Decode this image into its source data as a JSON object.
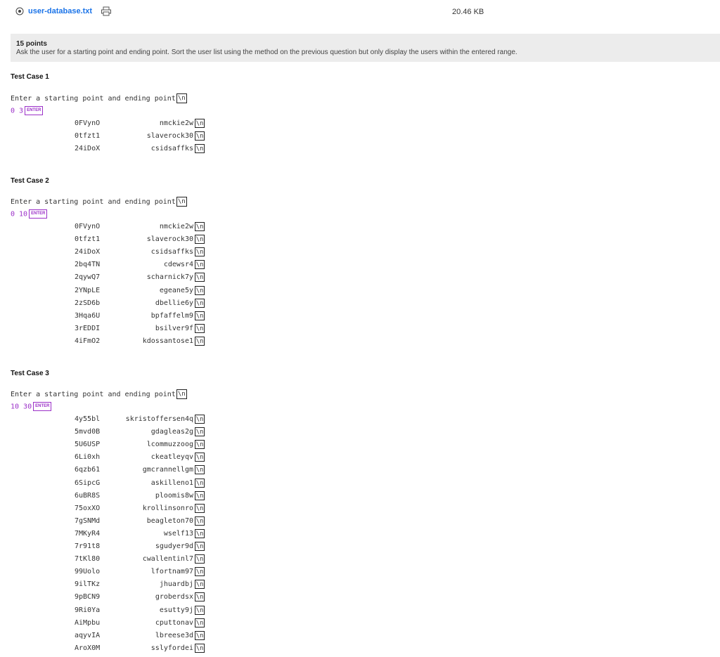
{
  "file": {
    "name": "user-database.txt",
    "size": "20.46 KB"
  },
  "question": {
    "points": "15 points",
    "prompt": "Ask the user for a starting point and ending point. Sort the user list using the method on the previous question but only display the users within the entered range."
  },
  "newline_marker": "\\n",
  "enter_label": "ENTER",
  "test_cases": [
    {
      "title": "Test Case 1",
      "prompt": "Enter a starting point and ending point",
      "input": "0 3",
      "rows": [
        [
          "0FVynO",
          "nmckie2w"
        ],
        [
          "0tfzt1",
          "slaverock30"
        ],
        [
          "24iDoX",
          "csidsaffks"
        ]
      ]
    },
    {
      "title": "Test Case 2",
      "prompt": "Enter a starting point and ending point",
      "input": "0 10",
      "rows": [
        [
          "0FVynO",
          "nmckie2w"
        ],
        [
          "0tfzt1",
          "slaverock30"
        ],
        [
          "24iDoX",
          "csidsaffks"
        ],
        [
          "2bq4TN",
          "cdewsr4"
        ],
        [
          "2qywQ7",
          "scharnick7y"
        ],
        [
          "2YNpLE",
          "egeane5y"
        ],
        [
          "2zSD6b",
          "dbellie6y"
        ],
        [
          "3Hqa6U",
          "bpfaffelm9"
        ],
        [
          "3rEDDI",
          "bsilver9f"
        ],
        [
          "4iFmO2",
          "kdossantose1"
        ]
      ]
    },
    {
      "title": "Test Case 3",
      "prompt": "Enter a starting point and ending point",
      "input": "10 30",
      "rows": [
        [
          "4y55bl",
          "skristoffersen4q"
        ],
        [
          "5mvd0B",
          "gdagleas2g"
        ],
        [
          "5U6USP",
          "lcommuzzoog"
        ],
        [
          "6Li0xh",
          "ckeatleyqv"
        ],
        [
          "6qzb61",
          "gmcrannellgm"
        ],
        [
          "6SipcG",
          "askilleno1"
        ],
        [
          "6uBR8S",
          "ploomis8w"
        ],
        [
          "75oxXO",
          "krollinsonro"
        ],
        [
          "7gSNMd",
          "beagleton70"
        ],
        [
          "7MKyR4",
          "wself13"
        ],
        [
          "7r91t8",
          "sgudyer9d"
        ],
        [
          "7tKl80",
          "cwallentinl7"
        ],
        [
          "99Uolo",
          "lfortnam97"
        ],
        [
          "9ilTKz",
          "jhuardbj"
        ],
        [
          "9pBCN9",
          "groberdsx"
        ],
        [
          "9Ri0Ya",
          "esutty9j"
        ],
        [
          "AiMpbu",
          "cputtonav"
        ],
        [
          "aqyvIA",
          "lbreese3d"
        ],
        [
          "AroX0M",
          "sslyfordei"
        ]
      ]
    }
  ]
}
